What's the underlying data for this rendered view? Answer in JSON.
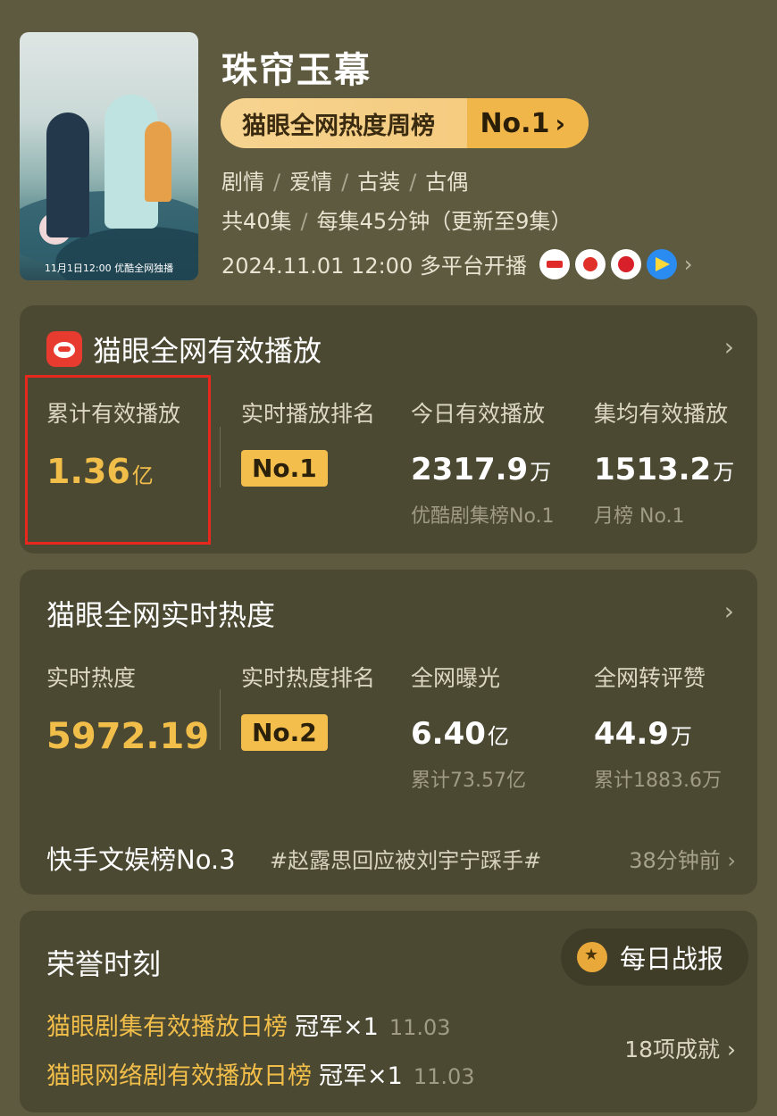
{
  "show": {
    "title": "珠帘玉幕",
    "poster_caption": "11月1日12:00 优酷全网独播",
    "rank_pill": {
      "label": "猫眼全网热度周榜",
      "rank": "No.1",
      "chevron": "›"
    },
    "tags": [
      "剧情",
      "爱情",
      "古装",
      "古偶"
    ],
    "episodes": [
      "共40集",
      "每集45分钟（更新至9集）"
    ],
    "release": "2024.11.01 12:00 多平台开播",
    "platform_icons": [
      "tencent-video-icon",
      "mango-tv-icon",
      "iqiyi-icon",
      "youku-icon"
    ]
  },
  "playback_card": {
    "title": "猫眼全网有效播放",
    "chevron": "›",
    "stats": [
      {
        "label": "累计有效播放",
        "value": "1.36",
        "unit": "亿"
      },
      {
        "label": "实时播放排名",
        "badge": "No.1"
      },
      {
        "label": "今日有效播放",
        "value": "2317.9",
        "unit": "万",
        "sub": "优酷剧集榜No.1"
      },
      {
        "label": "集均有效播放",
        "value": "1513.2",
        "unit": "万",
        "sub": "月榜 No.1"
      }
    ]
  },
  "heat_card": {
    "title": "猫眼全网实时热度",
    "chevron": "›",
    "stats": [
      {
        "label": "实时热度",
        "value": "5972.19"
      },
      {
        "label": "实时热度排名",
        "badge": "No.2"
      },
      {
        "label": "全网曝光",
        "value": "6.40",
        "unit": "亿",
        "sub": "累计73.57亿"
      },
      {
        "label": "全网转评赞",
        "value": "44.9",
        "unit": "万",
        "sub": "累计1883.6万"
      }
    ],
    "hot_rank": "快手文娱榜No.3",
    "hot_tag": "#赵露思回应被刘宇宁踩手#",
    "hot_time": "38分钟前 ›"
  },
  "honor_card": {
    "title": "荣誉时刻",
    "daily_button": "每日战报",
    "items": [
      {
        "name": "猫眼剧集有效播放日榜",
        "count": "冠军×1",
        "date": "11.03"
      },
      {
        "name": "猫眼网络剧有效播放日榜",
        "count": "冠军×1",
        "date": "11.03"
      }
    ],
    "achievements": "18项成就 ›"
  },
  "colors": {
    "background": "#5e5a3f",
    "card": "#4c4932",
    "accent_gold": "#f2be4a",
    "highlight_box": "#e8271f"
  }
}
